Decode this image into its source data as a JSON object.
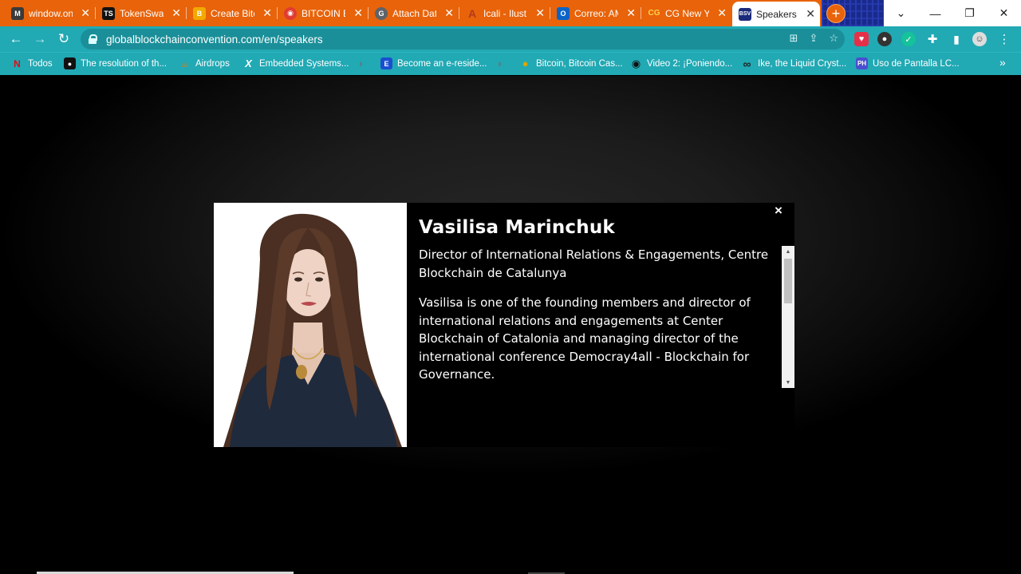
{
  "tabs": [
    {
      "title": "window.on",
      "favicon": "M",
      "favicon_color": "#3a3a3a"
    },
    {
      "title": "TokenSwap",
      "favicon": "TS",
      "favicon_color": "#111111"
    },
    {
      "title": "Create Bitc",
      "favicon": "B",
      "favicon_color": "#f2a900"
    },
    {
      "title": "BITCOIN El",
      "favicon": "◉",
      "favicon_color": "#e03c31"
    },
    {
      "title": "Attach Dat",
      "favicon": "G",
      "favicon_color": "#5f6368"
    },
    {
      "title": "Icali - Ilust",
      "favicon": "A",
      "favicon_color": "#b33a1c"
    },
    {
      "title": "Correo: AM",
      "favicon": "O",
      "favicon_color": "#0a64c8"
    },
    {
      "title": "CG New Yo",
      "favicon": "CG",
      "favicon_color": "#f08a1c"
    },
    {
      "title": "Speakers |",
      "favicon": "BSV",
      "favicon_color": "#1b2a7a"
    }
  ],
  "address_bar": {
    "url": "globalblockchainconvention.com/en/speakers"
  },
  "bookmarks": [
    {
      "label": "Todos",
      "favicon": "N",
      "color": "#e50914"
    },
    {
      "label": "The resolution of th...",
      "favicon": "●",
      "color": "#111111"
    },
    {
      "label": "Airdrops",
      "favicon": "☕",
      "color": "#c8802a"
    },
    {
      "label": "Embedded Systems...",
      "favicon": "X",
      "color": "#111111"
    },
    {
      "label": "",
      "favicon": "◐",
      "color": "#5a7d84"
    },
    {
      "label": "Become an e-reside...",
      "favicon": "E",
      "color": "#1a4fd0"
    },
    {
      "label": "",
      "favicon": "◐",
      "color": "#5a7d84"
    },
    {
      "label": "Bitcoin, Bitcoin Cas...",
      "favicon": "●",
      "color": "#d9a400"
    },
    {
      "label": "Video 2: ¡Poniendo...",
      "favicon": "◉",
      "color": "#222222"
    },
    {
      "label": "Ike, the Liquid Cryst...",
      "favicon": "∞",
      "color": "#333333"
    },
    {
      "label": "Uso de Pantalla LC...",
      "favicon": "PH",
      "color": "#4a4fd0"
    }
  ],
  "bookmarks_overflow": "»",
  "speaker": {
    "name": "Vasilisa Marinchuk",
    "role": "Director of International Relations & Engagements, Centre Blockchain de Catalunya",
    "bio": "Vasilisa is one of the founding members and director of international relations and engagements at Center Blockchain of Catalonia and managing director of the international conference Democray4all - Blockchain for Governance."
  },
  "icons": {
    "close": "×",
    "back": "←",
    "forward": "→",
    "reload": "↻",
    "new_tab": "+",
    "minimize": "—",
    "restore": "❐",
    "window_close": "✕",
    "tab_search": "⌄"
  }
}
